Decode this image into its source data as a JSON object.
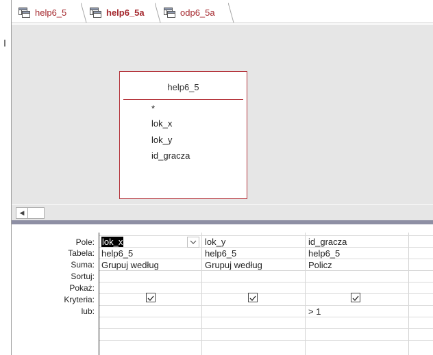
{
  "tabs": [
    {
      "label": "help6_5",
      "active": false
    },
    {
      "label": "help6_5a",
      "active": true
    },
    {
      "label": "odp6_5a",
      "active": false
    }
  ],
  "table_box": {
    "title": "help6_5",
    "fields": [
      "*",
      "lok_x",
      "lok_y",
      "id_gracza"
    ]
  },
  "scroll": {
    "left_arrow": "◀"
  },
  "grid": {
    "row_labels": [
      "Pole:",
      "Tabela:",
      "Suma:",
      "Sortuj:",
      "Pokaż:",
      "Kryteria:",
      "lub:"
    ],
    "columns": [
      {
        "pole": "lok_x",
        "tabela": "help6_5",
        "suma": "Grupuj według",
        "sortuj": "",
        "pokaz": true,
        "kryteria": "",
        "lub": ""
      },
      {
        "pole": "lok_y",
        "tabela": "help6_5",
        "suma": "Grupuj według",
        "sortuj": "",
        "pokaz": true,
        "kryteria": "",
        "lub": ""
      },
      {
        "pole": "id_gracza",
        "tabela": "help6_5",
        "suma": "Policz",
        "sortuj": "",
        "pokaz": true,
        "kryteria": "> 1",
        "lub": ""
      }
    ]
  },
  "colors": {
    "accent": "#a4262c",
    "table_border": "#b4333a",
    "splitter": "#8e8fa4"
  }
}
